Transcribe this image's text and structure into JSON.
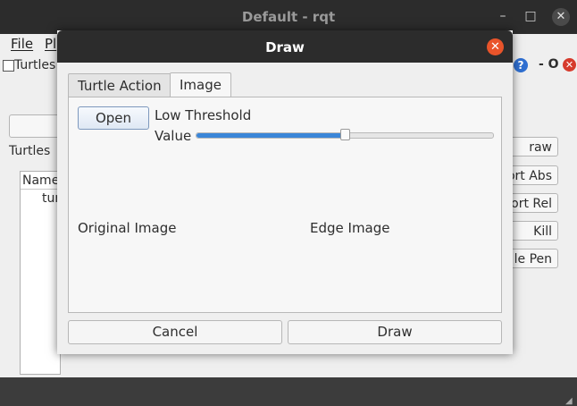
{
  "main_window": {
    "title": "Default - rqt",
    "controls": {
      "minimize": "–",
      "maximize": "□",
      "close": "✕"
    }
  },
  "menubar": {
    "file": "File",
    "plugins": "Pl"
  },
  "plugin": {
    "title": "Turtles",
    "help": "?",
    "dash_o": "- O",
    "close": "✕"
  },
  "turtles_panel": {
    "label": "Turtles",
    "list_header": "Name",
    "list_rows": [
      "tur"
    ]
  },
  "side_buttons": [
    "raw",
    "ort Abs",
    "ort Rel",
    "Kill",
    "le Pen"
  ],
  "dialog": {
    "title": "Draw",
    "close": "✕",
    "tabs": [
      {
        "label": "Turtle Action",
        "active": false
      },
      {
        "label": "Image",
        "active": true
      }
    ],
    "open_button": "Open",
    "low_threshold_label": "Low Threshold",
    "value_label": "Value",
    "slider_fraction": 0.5,
    "original_image_label": "Original Image",
    "edge_image_label": "Edge Image",
    "cancel_button": "Cancel",
    "draw_button": "Draw"
  },
  "colors": {
    "accent": "#3b86d8",
    "dialog_close": "#e9542a",
    "titlebar": "#2c2c2c"
  }
}
